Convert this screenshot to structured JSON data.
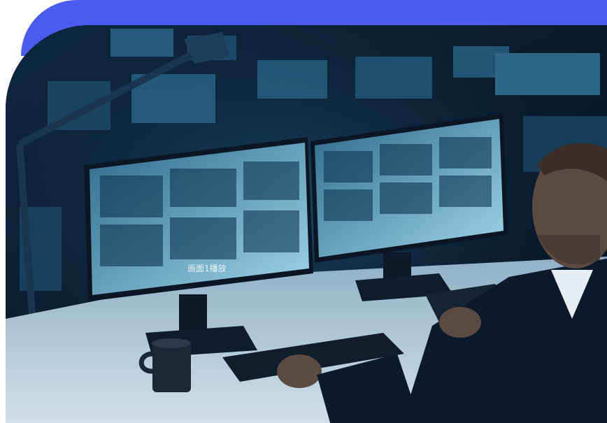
{
  "colors": {
    "accent_band": "#4a5cf0",
    "room_dark": "#07131f",
    "room_mid": "#10314a",
    "screen_glow": "#5fb6d8",
    "desk": "#c9dbe6",
    "suit": "#0b1a2b"
  },
  "photo": {
    "subject": "security-operator-at-monitors",
    "screen_caption": "画面1播放"
  }
}
